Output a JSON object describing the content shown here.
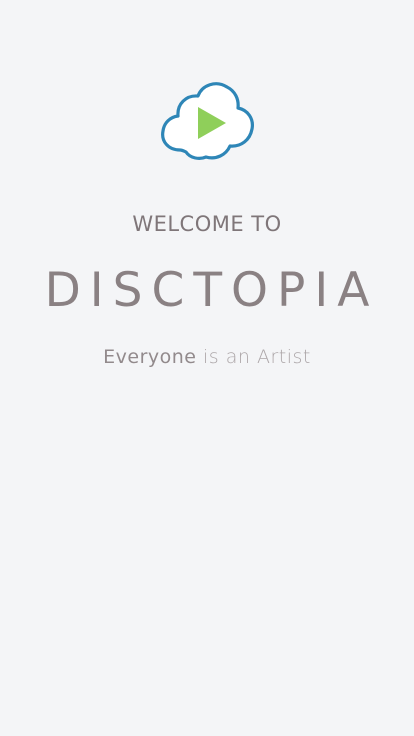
{
  "screen": {
    "logo_icon": "cloud-play-icon",
    "welcome_label": "WELCOME TO",
    "brand_name": "DISCTOPIA",
    "tagline": {
      "lead": "Everyone",
      "rest": " is an Artist"
    }
  },
  "colors": {
    "background": "#f4f5f7",
    "cloud_outline": "#2e86b7",
    "play_triangle": "#8fcf5a",
    "text": "#857c7f"
  }
}
